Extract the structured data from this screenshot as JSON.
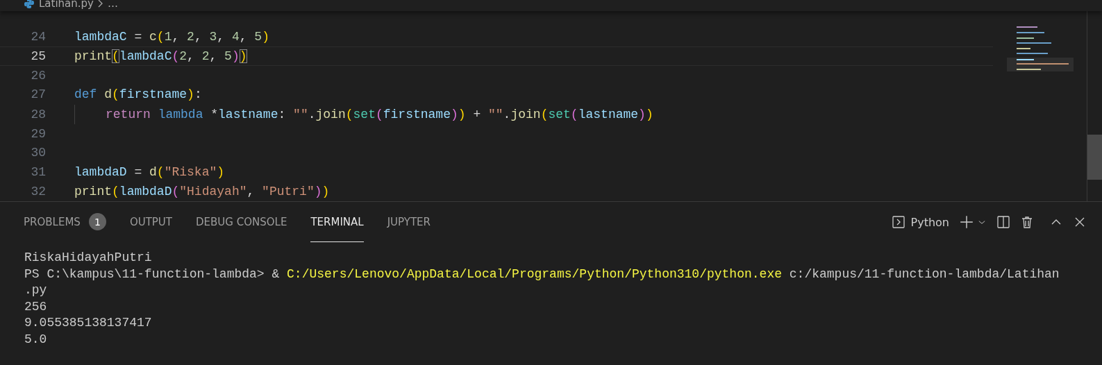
{
  "breadcrumb": {
    "file": "Latihan.py",
    "more": "…"
  },
  "editor": {
    "lines": [
      {
        "number": "24",
        "tokens": [
          {
            "text": "lambdaC",
            "kind": "variable"
          },
          {
            "text": " = ",
            "kind": "plain"
          },
          {
            "text": "c",
            "kind": "function"
          },
          {
            "text": "(",
            "kind": "bracket1"
          },
          {
            "text": "1",
            "kind": "number"
          },
          {
            "text": ", ",
            "kind": "plain"
          },
          {
            "text": "2",
            "kind": "number"
          },
          {
            "text": ", ",
            "kind": "plain"
          },
          {
            "text": "3",
            "kind": "number"
          },
          {
            "text": ", ",
            "kind": "plain"
          },
          {
            "text": "4",
            "kind": "number"
          },
          {
            "text": ", ",
            "kind": "plain"
          },
          {
            "text": "5",
            "kind": "number"
          },
          {
            "text": ")",
            "kind": "bracket1"
          }
        ]
      },
      {
        "number": "25",
        "current": true,
        "tokens": [
          {
            "text": "print",
            "kind": "function"
          },
          {
            "text": "(",
            "kind": "bracket1",
            "matched": true
          },
          {
            "text": "lambdaC",
            "kind": "variable"
          },
          {
            "text": "(",
            "kind": "bracket2"
          },
          {
            "text": "2",
            "kind": "number"
          },
          {
            "text": ", ",
            "kind": "plain"
          },
          {
            "text": "2",
            "kind": "number"
          },
          {
            "text": ", ",
            "kind": "plain"
          },
          {
            "text": "5",
            "kind": "number"
          },
          {
            "text": ")",
            "kind": "bracket2"
          },
          {
            "text": ")",
            "kind": "bracket1",
            "matched": true
          }
        ]
      },
      {
        "number": "26"
      },
      {
        "number": "27",
        "tokens": [
          {
            "text": "def ",
            "kind": "storage"
          },
          {
            "text": "d",
            "kind": "function"
          },
          {
            "text": "(",
            "kind": "bracket1"
          },
          {
            "text": "firstname",
            "kind": "variable"
          },
          {
            "text": ")",
            "kind": "bracket1"
          },
          {
            "text": ":",
            "kind": "plain"
          }
        ]
      },
      {
        "number": "28",
        "indent_guide": true,
        "tokens": [
          {
            "text": "return ",
            "kind": "keyword"
          },
          {
            "text": "lambda",
            "kind": "storage"
          },
          {
            "text": " *",
            "kind": "plain"
          },
          {
            "text": "lastname",
            "kind": "variable"
          },
          {
            "text": ": ",
            "kind": "plain"
          },
          {
            "text": "\"\"",
            "kind": "string"
          },
          {
            "text": ".",
            "kind": "plain"
          },
          {
            "text": "join",
            "kind": "function"
          },
          {
            "text": "(",
            "kind": "bracket1"
          },
          {
            "text": "set",
            "kind": "class"
          },
          {
            "text": "(",
            "kind": "bracket2"
          },
          {
            "text": "firstname",
            "kind": "variable"
          },
          {
            "text": ")",
            "kind": "bracket2"
          },
          {
            "text": ")",
            "kind": "bracket1"
          },
          {
            "text": " + ",
            "kind": "plain"
          },
          {
            "text": "\"\"",
            "kind": "string"
          },
          {
            "text": ".",
            "kind": "plain"
          },
          {
            "text": "join",
            "kind": "function"
          },
          {
            "text": "(",
            "kind": "bracket1"
          },
          {
            "text": "set",
            "kind": "class"
          },
          {
            "text": "(",
            "kind": "bracket2"
          },
          {
            "text": "lastname",
            "kind": "variable"
          },
          {
            "text": ")",
            "kind": "bracket2"
          },
          {
            "text": ")",
            "kind": "bracket1"
          }
        ]
      },
      {
        "number": "29"
      },
      {
        "number": "30"
      },
      {
        "number": "31",
        "tokens": [
          {
            "text": "lambdaD",
            "kind": "variable"
          },
          {
            "text": " = ",
            "kind": "plain"
          },
          {
            "text": "d",
            "kind": "function"
          },
          {
            "text": "(",
            "kind": "bracket1"
          },
          {
            "text": "\"Riska\"",
            "kind": "string"
          },
          {
            "text": ")",
            "kind": "bracket1"
          }
        ]
      },
      {
        "number": "32",
        "tokens": [
          {
            "text": "print",
            "kind": "function"
          },
          {
            "text": "(",
            "kind": "bracket1"
          },
          {
            "text": "lambdaD",
            "kind": "variable"
          },
          {
            "text": "(",
            "kind": "bracket2"
          },
          {
            "text": "\"Hidayah\"",
            "kind": "string"
          },
          {
            "text": ", ",
            "kind": "plain"
          },
          {
            "text": "\"Putri\"",
            "kind": "string"
          },
          {
            "text": ")",
            "kind": "bracket2"
          },
          {
            "text": ")",
            "kind": "bracket1"
          }
        ]
      }
    ]
  },
  "panel": {
    "tabs": [
      {
        "label": "PROBLEMS",
        "selected": false,
        "badge": "1"
      },
      {
        "label": "OUTPUT",
        "selected": false
      },
      {
        "label": "DEBUG CONSOLE",
        "selected": false
      },
      {
        "label": "TERMINAL",
        "selected": true
      },
      {
        "label": "JUPYTER",
        "selected": false
      }
    ],
    "terminal_name": "Python",
    "terminal_lines": [
      {
        "parts": [
          {
            "text": "RiskaHidayahPutri",
            "kind": "output"
          }
        ]
      },
      {
        "parts": [
          {
            "text": "PS C:\\kampus\\11-function-lambda> & ",
            "kind": "output"
          },
          {
            "text": "C:/Users/Lenovo/AppData/Local/Programs/Python/Python310/python.exe",
            "kind": "command"
          },
          {
            "text": " c:/kampus/11-function-lambda/Latihan",
            "kind": "output"
          }
        ]
      },
      {
        "parts": [
          {
            "text": ".py",
            "kind": "output"
          }
        ]
      },
      {
        "parts": [
          {
            "text": "256",
            "kind": "output"
          }
        ]
      },
      {
        "parts": [
          {
            "text": "9.055385138137417",
            "kind": "output"
          }
        ]
      },
      {
        "parts": [
          {
            "text": "5.0",
            "kind": "output"
          }
        ]
      }
    ]
  }
}
